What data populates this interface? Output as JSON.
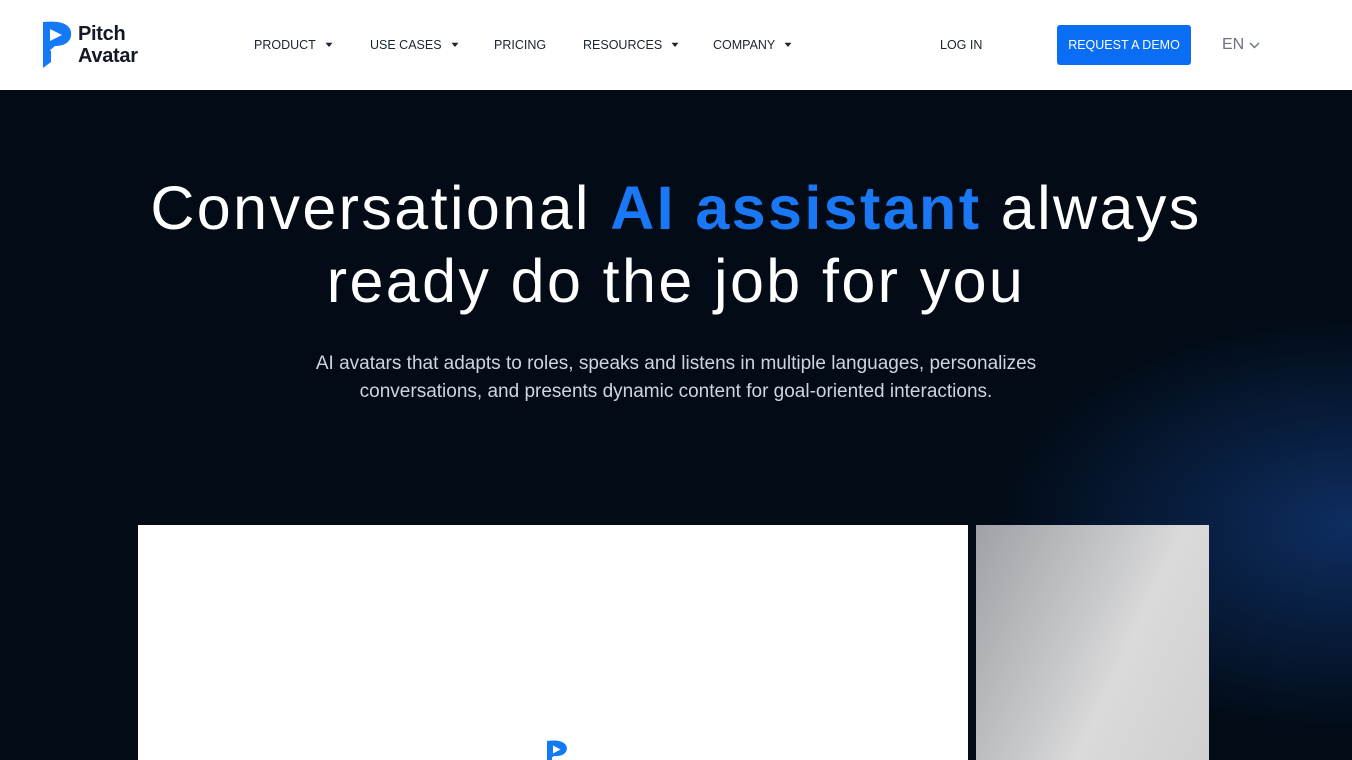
{
  "header": {
    "logo": {
      "line1": "Pitch",
      "line2": "Avatar",
      "accent_color": "#1479f5"
    },
    "nav": [
      {
        "label": "PRODUCT",
        "has_dropdown": true
      },
      {
        "label": "USE CASES",
        "has_dropdown": true
      },
      {
        "label": "PRICING",
        "has_dropdown": false
      },
      {
        "label": "RESOURCES",
        "has_dropdown": true
      },
      {
        "label": "COMPANY",
        "has_dropdown": true
      }
    ],
    "login_label": "LOG IN",
    "cta_label": "REQUEST A DEMO",
    "cta_color": "#0a6ef5",
    "language": "EN"
  },
  "hero": {
    "title_part1": "Conversational ",
    "title_accent": "AI assistant",
    "title_part2": " always",
    "title_line2": "ready do the job for you",
    "subtitle_line1": "AI avatars that adapts to roles, speaks and listens in multiple languages, personalizes",
    "subtitle_line2": "conversations, and presents dynamic content for goal-oriented interactions.",
    "accent_color": "#1a78f5",
    "background_color": "#020b16"
  },
  "media": {
    "video_icon": "play-logo-icon",
    "side_card": "preview-thumbnail"
  }
}
